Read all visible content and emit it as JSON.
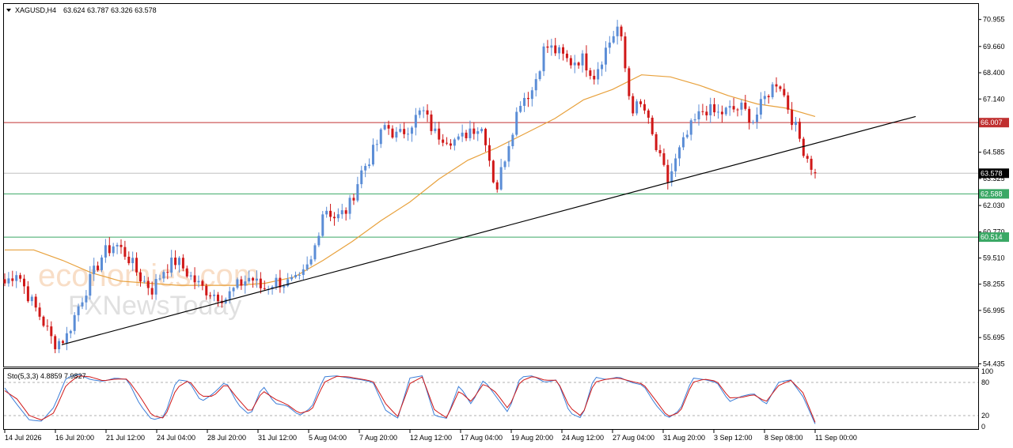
{
  "symbol_header": {
    "symbol": "XAGUSD,H4",
    "ohlc": "63.624 63.787 63.326 63.578"
  },
  "stoch_header": {
    "label": "Sto(5,3,3) 4.8859 7.9827"
  },
  "watermark": {
    "line1": "economies.com",
    "line2": "FXNewsToday"
  },
  "colors": {
    "bull": "#5b8dd6",
    "bear": "#d01818",
    "ma": "#e8a13c",
    "resistance": "#c03030",
    "support": "#3aa865",
    "trendline": "#000000",
    "stoch_main": "#3d7fd8",
    "stoch_signal": "#d01818"
  },
  "chart_data": [
    {
      "type": "candlestick",
      "title": "XAGUSD,H4",
      "ylim": [
        54.3,
        71.7
      ],
      "y_ticks": [
        "70.955",
        "69.660",
        "68.400",
        "67.140",
        "64.585",
        "63.325",
        "62.030",
        "60.770",
        "59.510",
        "58.255",
        "56.995",
        "55.695",
        "54.435"
      ],
      "x_ticks": [
        "14 Jul 2026",
        "16 Jul 20:00",
        "21 Jul 12:00",
        "24 Jul 04:00",
        "28 Jul 20:00",
        "31 Jul 12:00",
        "5 Aug 04:00",
        "7 Aug 20:00",
        "12 Aug 12:00",
        "17 Aug 04:00",
        "19 Aug 20:00",
        "24 Aug 12:00",
        "27 Aug 04:00",
        "31 Aug 20:00",
        "3 Sep 12:00",
        "8 Sep 08:00",
        "11 Sep 00:00"
      ],
      "path_points": [
        58.3,
        58.9,
        57.6,
        56.6,
        55.4,
        55.7,
        57.2,
        58.5,
        59.7,
        60.2,
        59.6,
        58.6,
        58.0,
        59.0,
        59.4,
        58.7,
        58.1,
        57.8,
        57.6,
        58.2,
        58.6,
        58.0,
        58.4,
        58.3,
        58.4,
        59.4,
        62.0,
        61.4,
        61.9,
        63.6,
        64.6,
        65.9,
        65.3,
        65.9,
        66.6,
        65.5,
        65.3,
        65.1,
        65.8,
        65.7,
        62.7,
        65.0,
        67.1,
        67.6,
        69.7,
        69.4,
        68.9,
        69.1,
        68.3,
        69.6,
        70.7,
        66.7,
        66.8,
        64.8,
        63.2,
        64.7,
        65.9,
        66.7,
        66.4,
        66.6,
        66.7,
        66.1,
        67.3,
        68.1,
        66.4,
        64.8,
        63.578
      ],
      "ohlc_last": {
        "open": 63.624,
        "high": 63.787,
        "low": 63.326,
        "close": 63.578
      },
      "last_price_tag": "63.578",
      "moving_average_path": [
        59.9,
        59.9,
        59.4,
        58.8,
        58.4,
        58.3,
        58.2,
        58.2,
        58.2,
        58.3,
        58.6,
        59.4,
        60.3,
        61.3,
        62.2,
        63.3,
        64.2,
        64.8,
        65.5,
        66.2,
        67.1,
        67.6,
        68.3,
        68.2,
        67.8,
        67.3,
        66.9,
        66.7,
        66.3
      ],
      "horizontal_levels": [
        {
          "value": 66.007,
          "label": "66.007",
          "role": "resistance"
        },
        {
          "value": 62.588,
          "label": "62.588",
          "role": "support"
        },
        {
          "value": 60.514,
          "label": "60.514",
          "role": "support"
        }
      ],
      "trendline": {
        "from": 55.35,
        "to": 66.3
      }
    },
    {
      "type": "line",
      "title": "Sto(5,3,3) 4.8859 7.9827",
      "ylim": [
        0,
        100
      ],
      "y_ticks": [
        "100",
        "80",
        "20",
        "0"
      ],
      "levels": [
        80,
        20
      ],
      "main_values": [
        70,
        40,
        12,
        10,
        35,
        88,
        95,
        85,
        82,
        88,
        85,
        40,
        12,
        18,
        85,
        82,
        45,
        60,
        82,
        40,
        20,
        75,
        42,
        38,
        20,
        35,
        90,
        92,
        88,
        85,
        80,
        30,
        15,
        88,
        92,
        20,
        15,
        75,
        40,
        85,
        55,
        25,
        90,
        92,
        80,
        85,
        25,
        15,
        90,
        85,
        90,
        80,
        75,
        40,
        15,
        30,
        88,
        85,
        80,
        45,
        55,
        60,
        40,
        80,
        85,
        55,
        5
      ],
      "signal_values": [
        65,
        50,
        20,
        12,
        25,
        75,
        92,
        90,
        83,
        86,
        86,
        55,
        20,
        15,
        70,
        84,
        55,
        55,
        78,
        50,
        25,
        65,
        50,
        40,
        24,
        30,
        80,
        91,
        90,
        86,
        82,
        42,
        18,
        78,
        90,
        30,
        16,
        65,
        45,
        78,
        62,
        32,
        82,
        91,
        84,
        84,
        35,
        18,
        80,
        86,
        88,
        82,
        77,
        48,
        18,
        26,
        80,
        86,
        82,
        52,
        53,
        58,
        45,
        74,
        84,
        62,
        8
      ]
    }
  ]
}
